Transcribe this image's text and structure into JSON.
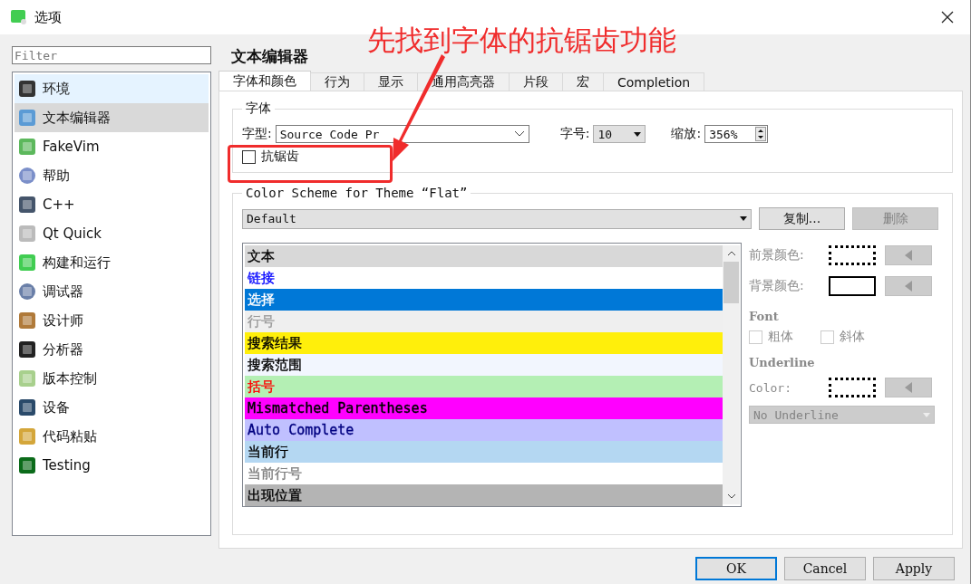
{
  "window": {
    "title": "选项"
  },
  "annotation": {
    "text": "先找到字体的抗锯齿功能"
  },
  "sidebar": {
    "filter": {
      "placeholder": "Filter"
    },
    "items": [
      {
        "label": "环境",
        "selected": false,
        "hovered": true
      },
      {
        "label": "文本编辑器",
        "selected": true,
        "hovered": false
      },
      {
        "label": "FakeVim",
        "selected": false,
        "hovered": false
      },
      {
        "label": "帮助",
        "selected": false,
        "hovered": false
      },
      {
        "label": "C++",
        "selected": false,
        "hovered": false
      },
      {
        "label": "Qt Quick",
        "selected": false,
        "hovered": false
      },
      {
        "label": "构建和运行",
        "selected": false,
        "hovered": false
      },
      {
        "label": "调试器",
        "selected": false,
        "hovered": false
      },
      {
        "label": "设计师",
        "selected": false,
        "hovered": false
      },
      {
        "label": "分析器",
        "selected": false,
        "hovered": false
      },
      {
        "label": "版本控制",
        "selected": false,
        "hovered": false
      },
      {
        "label": "设备",
        "selected": false,
        "hovered": false
      },
      {
        "label": "代码粘贴",
        "selected": false,
        "hovered": false
      },
      {
        "label": "Testing",
        "selected": false,
        "hovered": false
      }
    ]
  },
  "page_title": "文本编辑器",
  "tabs": [
    {
      "label": "字体和颜色",
      "selected": true
    },
    {
      "label": "行为",
      "selected": false
    },
    {
      "label": "显示",
      "selected": false
    },
    {
      "label": "通用高亮器",
      "selected": false
    },
    {
      "label": "片段",
      "selected": false
    },
    {
      "label": "宏",
      "selected": false
    },
    {
      "label": "Completion",
      "selected": false
    }
  ],
  "font_group": {
    "title": "字体",
    "family_label": "字型:",
    "family": "Source Code Pr",
    "size_label": "字号:",
    "size": "10",
    "zoom_label": "缩放:",
    "zoom": "356%",
    "antialias": {
      "label": "抗锯齿",
      "checked": false
    }
  },
  "scheme_group": {
    "title": "Color Scheme for Theme “Flat”",
    "scheme": "Default",
    "copy_button": {
      "label": "复制...",
      "disabled": false
    },
    "delete_button": {
      "label": "删除",
      "disabled": true
    },
    "items": [
      {
        "color": "#d8d8d8",
        "text": {
          "label": "文本",
          "color": "#000000"
        }
      },
      {
        "color": "#ffffff",
        "text": {
          "label": "链接",
          "color": "#0000ff"
        }
      },
      {
        "color": "#0078d7",
        "text": {
          "label": "选择",
          "color": "#ffffff"
        }
      },
      {
        "color": "#efefef",
        "text": {
          "label": "行号",
          "color": "#9a9a9a"
        }
      },
      {
        "color": "#ffef0b",
        "text": {
          "label": "搜索结果",
          "color": "#000000"
        }
      },
      {
        "color": "#f2f6fe",
        "text": {
          "label": "搜索范围",
          "color": "#000000"
        }
      },
      {
        "color": "#b4efb4",
        "text": {
          "label": "括号",
          "color": "#ff0000"
        }
      },
      {
        "color": "#ff00ff",
        "text": {
          "label": "Mismatched Parentheses",
          "color": "#000000"
        }
      },
      {
        "color": "#c0c0ff",
        "text": {
          "label": "Auto Complete",
          "color": "#000080"
        }
      },
      {
        "color": "#b4d7f2",
        "text": {
          "label": "当前行",
          "color": "#000000"
        }
      },
      {
        "color": "#ffffff",
        "text": {
          "label": "当前行号",
          "color": "#808080"
        }
      },
      {
        "color": "#b4b4b4",
        "text": {
          "label": "出现位置",
          "color": "#000000"
        }
      }
    ],
    "foreground_label": "前景颜色:",
    "background_label": "背景颜色:",
    "font_heading": "Font",
    "bold": {
      "label": "粗体",
      "checked": false
    },
    "italic": {
      "label": "斜体",
      "checked": false
    },
    "underline_heading": "Underline",
    "underline_color_label": "Color:",
    "underline_style": "No Underline"
  },
  "buttons": [
    {
      "label": "OK",
      "default": true
    },
    {
      "label": "Cancel",
      "default": false
    },
    {
      "label": "Apply",
      "default": false
    }
  ]
}
